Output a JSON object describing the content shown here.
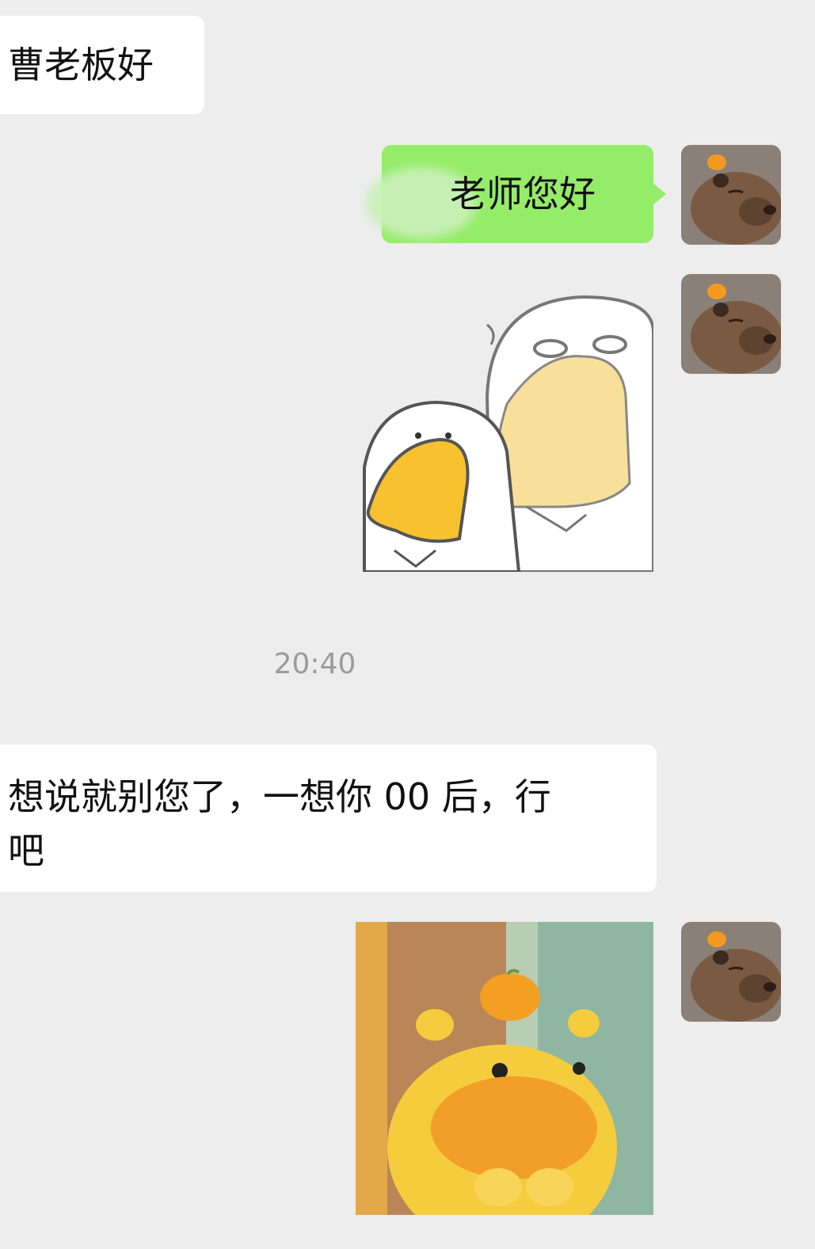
{
  "chat": {
    "messages": [
      {
        "direction": "incoming",
        "type": "text",
        "text": "曹老板好"
      },
      {
        "direction": "outgoing",
        "type": "text",
        "text": "老师您好"
      },
      {
        "direction": "outgoing",
        "type": "sticker",
        "sticker": "white-duck-sticker"
      },
      {
        "direction": "outgoing",
        "type": "sticker",
        "sticker": "yellow-capybara-sticker"
      }
    ],
    "timestamp": "20:40",
    "incoming_2": {
      "line1": "想说就别您了，一想你 00 后，行",
      "line2": "吧"
    }
  },
  "colors": {
    "background": "#ededed",
    "incoming_bubble": "#ffffff",
    "outgoing_bubble": "#95ec69",
    "timestamp_text": "#9b9b9b"
  },
  "icons": [
    "capybara-avatar-icon"
  ]
}
